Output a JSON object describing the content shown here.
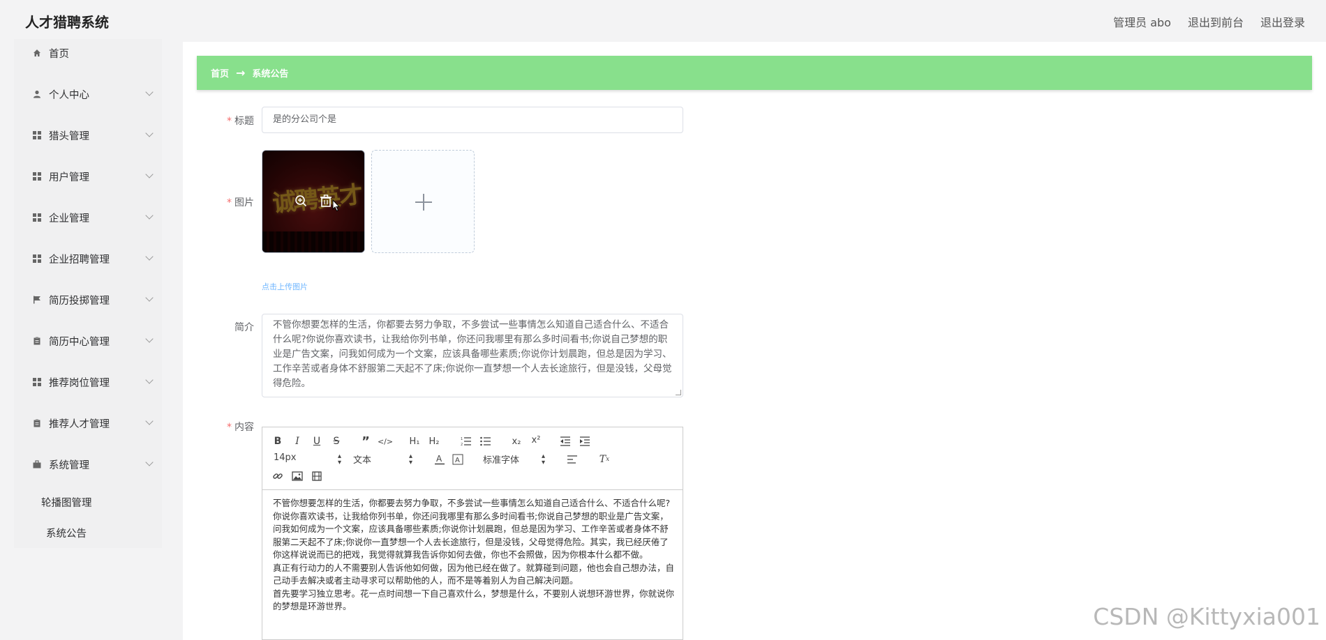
{
  "app": {
    "title": "人才猎聘系统"
  },
  "top_links": {
    "admin": "管理员 abo",
    "front": "退出到前台",
    "logout": "退出登录"
  },
  "sidebar": {
    "items": [
      {
        "label": "首页",
        "icon": "home-icon"
      },
      {
        "label": "个人中心",
        "icon": "user-icon"
      },
      {
        "label": "猎头管理",
        "icon": "grid-icon"
      },
      {
        "label": "用户管理",
        "icon": "grid-icon"
      },
      {
        "label": "企业管理",
        "icon": "grid-icon"
      },
      {
        "label": "企业招聘管理",
        "icon": "grid-icon"
      },
      {
        "label": "简历投掷管理",
        "icon": "flag-icon"
      },
      {
        "label": "简历中心管理",
        "icon": "clipboard-icon"
      },
      {
        "label": "推荐岗位管理",
        "icon": "grid-icon"
      },
      {
        "label": "推荐人才管理",
        "icon": "clipboard-icon"
      },
      {
        "label": "系统管理",
        "icon": "briefcase-icon"
      }
    ],
    "sub_items": [
      "轮播图管理",
      "系统公告"
    ]
  },
  "breadcrumb": {
    "home": "首页",
    "current": "系统公告"
  },
  "form": {
    "title_label": "标题",
    "title_value": "是的分公司个是",
    "image_label": "图片",
    "image_text": "诚聘英才",
    "upload_tip": "点击上传图片",
    "intro_label": "简介",
    "intro_value": "不管你想要怎样的生活，你都要去努力争取，不多尝试一些事情怎么知道自己适合什么、不适合什么呢?你说你喜欢读书，让我给你列书单，你还问我哪里有那么多时间看书;你说自己梦想的职业是广告文案，问我如何成为一个文案，应该具备哪些素质;你说你计划晨跑，但总是因为学习、工作辛苦或者身体不舒服第二天起不了床;你说你一直梦想一个人去长途旅行，但是没钱，父母觉得危险。",
    "content_label": "内容"
  },
  "editor": {
    "font_size": "14px",
    "header_select": "文本",
    "font_family": "标准字体",
    "paragraphs": [
      "不管你想要怎样的生活，你都要去努力争取，不多尝试一些事情怎么知道自己适合什么、不适合什么呢?",
      "你说你喜欢读书，让我给你列书单，你还问我哪里有那么多时间看书;你说自己梦想的职业是广告文案，问我如何成为一个文案，应该具备哪些素质;你说你计划晨跑，但总是因为学习、工作辛苦或者身体不舒服第二天起不了床;你说你一直梦想一个人去长途旅行，但是没钱，父母觉得危险。其实，我已经厌倦了你这样说说而已的把戏，我觉得就算我告诉你如何去做，你也不会照做，因为你根本什么都不做。",
      "真正有行动力的人不需要别人告诉他如何做，因为他已经在做了。就算碰到问题，他也会自己想办法，自己动手去解决或者主动寻求可以帮助他的人，而不是等着别人为自己解决问题。",
      "首先要学习独立思考。花一点时间想一下自己喜欢什么，梦想是什么，不要别人说想环游世界，你就说你的梦想是环游世界。"
    ]
  },
  "watermark": "CSDN @Kittyxia001",
  "colors": {
    "accent": "#88e08c",
    "required": "#f56c6c",
    "link": "#409eff"
  }
}
